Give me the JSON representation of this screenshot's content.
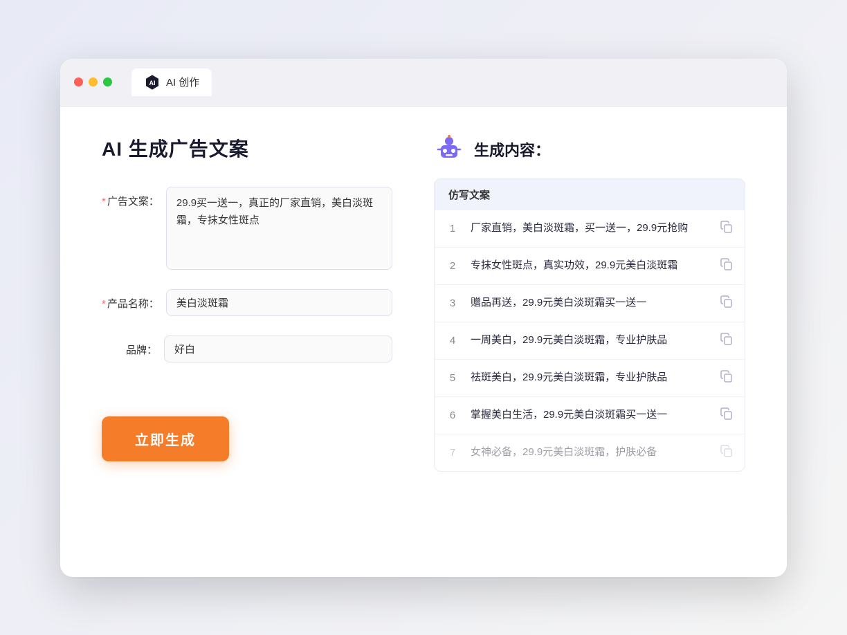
{
  "window": {
    "tab_label": "AI 创作"
  },
  "page": {
    "title": "AI 生成广告文案",
    "result_title": "生成内容："
  },
  "form": {
    "ad_text_label": "广告文案：",
    "ad_text_required": "*",
    "ad_text_value": "29.9买一送一，真正的厂家直销，美白淡斑霜，专抹女性斑点",
    "product_name_label": "产品名称：",
    "product_name_required": "*",
    "product_name_value": "美白淡斑霜",
    "brand_label": "品牌：",
    "brand_value": "好白",
    "generate_button": "立即生成"
  },
  "results": {
    "table_header": "仿写文案",
    "items": [
      {
        "num": "1",
        "text": "厂家直销，美白淡斑霜，买一送一，29.9元抢购",
        "faded": false
      },
      {
        "num": "2",
        "text": "专抹女性斑点，真实功效，29.9元美白淡斑霜",
        "faded": false
      },
      {
        "num": "3",
        "text": "赠品再送，29.9元美白淡斑霜买一送一",
        "faded": false
      },
      {
        "num": "4",
        "text": "一周美白，29.9元美白淡斑霜，专业护肤品",
        "faded": false
      },
      {
        "num": "5",
        "text": "祛斑美白，29.9元美白淡斑霜，专业护肤品",
        "faded": false
      },
      {
        "num": "6",
        "text": "掌握美白生活，29.9元美白淡斑霜买一送一",
        "faded": false
      },
      {
        "num": "7",
        "text": "女神必备，29.9元美白淡斑霜，护肤必备",
        "faded": true
      }
    ]
  }
}
